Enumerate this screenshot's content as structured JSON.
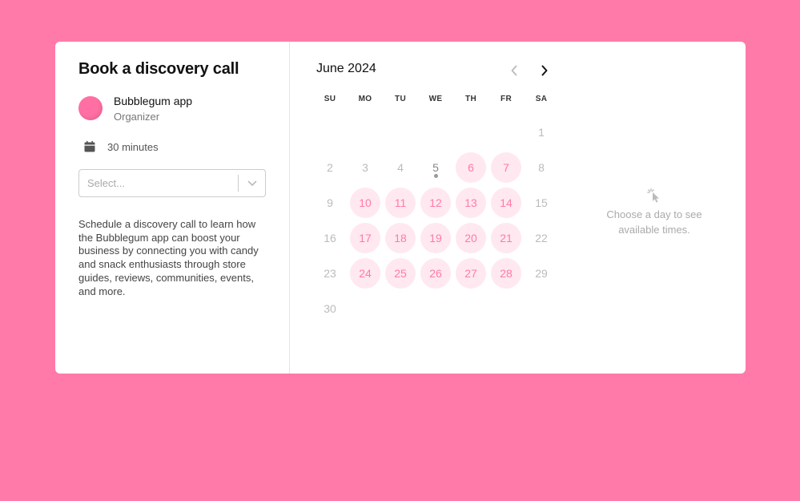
{
  "booking": {
    "title": "Book a discovery call",
    "organizer_name": "Bubblegum app",
    "organizer_role": "Organizer",
    "duration": "30 minutes",
    "select_placeholder": "Select...",
    "description": "Schedule a discovery call to learn how the Bubblegum app can boost your business by connecting you with candy and snack enthusiasts through store guides, reviews, communities, events, and more."
  },
  "calendar": {
    "month_label": "June 2024",
    "weekdays": [
      "SU",
      "MO",
      "TU",
      "WE",
      "TH",
      "FR",
      "SA"
    ],
    "first_weekday_index": 6,
    "days_in_month": 30,
    "today": 5,
    "available_days": [
      6,
      7,
      10,
      11,
      12,
      13,
      14,
      17,
      18,
      19,
      20,
      21,
      24,
      25,
      26,
      27,
      28
    ]
  },
  "times_panel": {
    "empty_message": "Choose a day to see available times."
  },
  "colors": {
    "background": "#ff7aa8",
    "accent": "#ff7aa8",
    "available_day_bg": "#ffe8f0",
    "avatar": "#ff6fa3"
  },
  "icons": [
    "calendar-icon",
    "chevron-down-icon",
    "chevron-left-icon",
    "chevron-right-icon",
    "pointer-click-icon"
  ]
}
